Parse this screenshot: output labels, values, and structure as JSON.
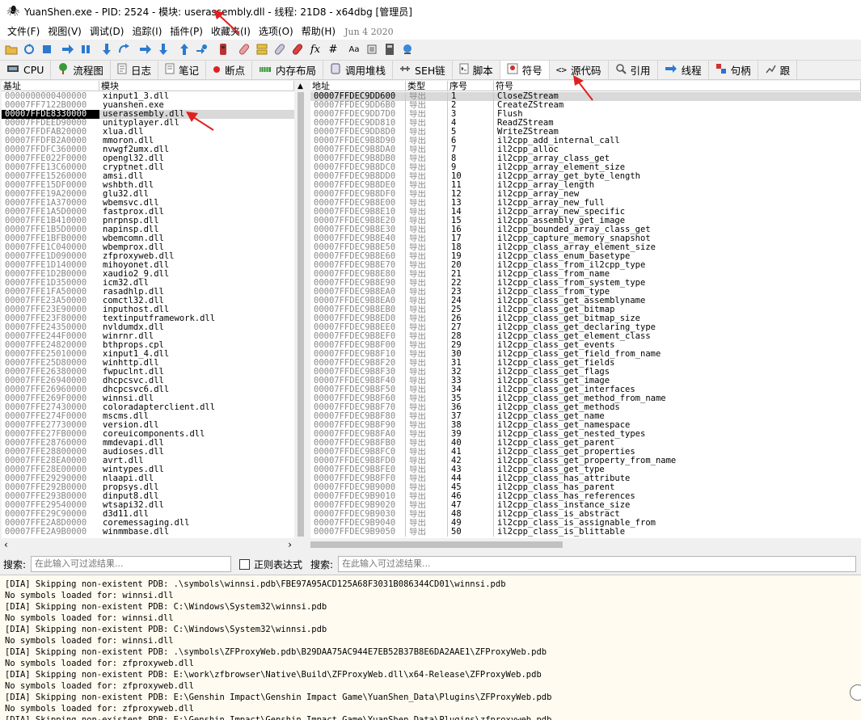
{
  "window": {
    "title": "YuanShen.exe - PID: 2524 - 模块: userassembly.dll - 线程: 21D8 - x64dbg [管理员]"
  },
  "menu": {
    "items": [
      "文件(F)",
      "视图(V)",
      "调试(D)",
      "追踪(I)",
      "插件(P)",
      "收藏夹(I)",
      "选项(O)",
      "帮助(H)"
    ],
    "date": "Jun 4 2020"
  },
  "toolbar": {
    "icons": [
      "open-icon",
      "restart-icon",
      "stop-icon",
      "run-icon",
      "pause-icon",
      "step-into-icon",
      "step-over-icon",
      "trace-into-icon",
      "trace-over-icon",
      "execute-till-return-icon",
      "run-to-user-code-icon",
      "scylla-icon",
      "comment-icon",
      "label-icon",
      "bookmark-icon",
      "function-icon",
      "fx-icon",
      "hash-icon",
      "font-icon",
      "settings-icon",
      "calculator-icon",
      "globe-icon"
    ],
    "hash_label": "#",
    "fx_label": "fx",
    "font_label": "Aa"
  },
  "tabs": [
    {
      "label": "CPU",
      "icon": "cpu-icon"
    },
    {
      "label": "流程图",
      "icon": "graph-icon"
    },
    {
      "label": "日志",
      "icon": "log-icon"
    },
    {
      "label": "笔记",
      "icon": "notes-icon"
    },
    {
      "label": "断点",
      "icon": "breakpoint-icon"
    },
    {
      "label": "内存布局",
      "icon": "memory-map-icon"
    },
    {
      "label": "调用堆栈",
      "icon": "call-stack-icon"
    },
    {
      "label": "SEH链",
      "icon": "seh-icon"
    },
    {
      "label": "脚本",
      "icon": "script-icon"
    },
    {
      "label": "符号",
      "icon": "symbols-icon",
      "active": true
    },
    {
      "label": "源代码",
      "icon": "source-icon"
    },
    {
      "label": "引用",
      "icon": "references-icon"
    },
    {
      "label": "线程",
      "icon": "threads-icon"
    },
    {
      "label": "句柄",
      "icon": "handles-icon"
    },
    {
      "label": "跟",
      "icon": "trace-icon"
    }
  ],
  "modules": {
    "headers": {
      "base": "基址",
      "module": "模块"
    },
    "rows": [
      {
        "base": "0000000000400000",
        "name": "xinput1_3.dll"
      },
      {
        "base": "00007FF7122B0000",
        "name": "yuanshen.exe"
      },
      {
        "base": "00007FFDE8330000",
        "name": "userassembly.dll",
        "selected": true
      },
      {
        "base": "00007FFDEED90000",
        "name": "unityplayer.dll"
      },
      {
        "base": "00007FFDFAB20000",
        "name": "xlua.dll"
      },
      {
        "base": "00007FFDFB2A0000",
        "name": "mmoron.dll"
      },
      {
        "base": "00007FFDFC360000",
        "name": "nvwgf2umx.dll"
      },
      {
        "base": "00007FFE022F0000",
        "name": "opengl32.dll"
      },
      {
        "base": "00007FFE13C60000",
        "name": "cryptnet.dll"
      },
      {
        "base": "00007FFE15260000",
        "name": "amsi.dll"
      },
      {
        "base": "00007FFE15DF0000",
        "name": "wshbth.dll"
      },
      {
        "base": "00007FFE19A20000",
        "name": "glu32.dll"
      },
      {
        "base": "00007FFE1A370000",
        "name": "wbemsvc.dll"
      },
      {
        "base": "00007FFE1A5D0000",
        "name": "fastprox.dll"
      },
      {
        "base": "00007FFE1B410000",
        "name": "pnrpnsp.dll"
      },
      {
        "base": "00007FFE1B5D0000",
        "name": "napinsp.dll"
      },
      {
        "base": "00007FFE1BFB0000",
        "name": "wbemcomn.dll"
      },
      {
        "base": "00007FFE1C040000",
        "name": "wbemprox.dll"
      },
      {
        "base": "00007FFE1D090000",
        "name": "zfproxyweb.dll"
      },
      {
        "base": "00007FFE1D140000",
        "name": "mihoyonet.dll"
      },
      {
        "base": "00007FFE1D2B0000",
        "name": "xaudio2_9.dll"
      },
      {
        "base": "00007FFE1D350000",
        "name": "icm32.dll"
      },
      {
        "base": "00007FFE1FA50000",
        "name": "rasadhlp.dll"
      },
      {
        "base": "00007FFE23A50000",
        "name": "comctl32.dll"
      },
      {
        "base": "00007FFE23E90000",
        "name": "inputhost.dll"
      },
      {
        "base": "00007FFE23F80000",
        "name": "textinputframework.dll"
      },
      {
        "base": "00007FFE24350000",
        "name": "nvldumdx.dll"
      },
      {
        "base": "00007FFE244F0000",
        "name": "winrnr.dll"
      },
      {
        "base": "00007FFE24820000",
        "name": "bthprops.cpl"
      },
      {
        "base": "00007FFE25010000",
        "name": "xinput1_4.dll"
      },
      {
        "base": "00007FFE25D80000",
        "name": "winhttp.dll"
      },
      {
        "base": "00007FFE26380000",
        "name": "fwpuclnt.dll"
      },
      {
        "base": "00007FFE26940000",
        "name": "dhcpcsvc.dll"
      },
      {
        "base": "00007FFE26960000",
        "name": "dhcpcsvc6.dll"
      },
      {
        "base": "00007FFE269F0000",
        "name": "winnsi.dll"
      },
      {
        "base": "00007FFE27430000",
        "name": "coloradapterclient.dll"
      },
      {
        "base": "00007FFE274F0000",
        "name": "mscms.dll"
      },
      {
        "base": "00007FFE27730000",
        "name": "version.dll"
      },
      {
        "base": "00007FFE27FB0000",
        "name": "coreuicomponents.dll"
      },
      {
        "base": "00007FFE28760000",
        "name": "mmdevapi.dll"
      },
      {
        "base": "00007FFE28800000",
        "name": "audioses.dll"
      },
      {
        "base": "00007FFE28EA0000",
        "name": "avrt.dll"
      },
      {
        "base": "00007FFE28E00000",
        "name": "wintypes.dll"
      },
      {
        "base": "00007FFE29290000",
        "name": "nlaapi.dll"
      },
      {
        "base": "00007FFE292B0000",
        "name": "propsys.dll"
      },
      {
        "base": "00007FFE293B0000",
        "name": "dinput8.dll"
      },
      {
        "base": "00007FFE29540000",
        "name": "wtsapi32.dll"
      },
      {
        "base": "00007FFE29C90000",
        "name": "d3d11.dll"
      },
      {
        "base": "00007FFE2A8D0000",
        "name": "coremessaging.dll"
      },
      {
        "base": "00007FFE2A9B0000",
        "name": "winmmbase.dll"
      }
    ]
  },
  "symbols": {
    "headers": {
      "address": "地址",
      "type": "类型",
      "ordinal": "序号",
      "symbol": "符号"
    },
    "type_value": "导出",
    "rows": [
      {
        "addr": "00007FFDEC9DD600",
        "ord": "1",
        "sym": "CloseZStream"
      },
      {
        "addr": "00007FFDEC9DD6B0",
        "ord": "2",
        "sym": "CreateZStream"
      },
      {
        "addr": "00007FFDEC9DD7D0",
        "ord": "3",
        "sym": "Flush"
      },
      {
        "addr": "00007FFDEC9DD810",
        "ord": "4",
        "sym": "ReadZStream"
      },
      {
        "addr": "00007FFDEC9DD8D0",
        "ord": "5",
        "sym": "WriteZStream"
      },
      {
        "addr": "00007FFDEC9B8D90",
        "ord": "6",
        "sym": "il2cpp_add_internal_call"
      },
      {
        "addr": "00007FFDEC9B8DA0",
        "ord": "7",
        "sym": "il2cpp_alloc"
      },
      {
        "addr": "00007FFDEC9B8DB0",
        "ord": "8",
        "sym": "il2cpp_array_class_get"
      },
      {
        "addr": "00007FFDEC9B8DC0",
        "ord": "9",
        "sym": "il2cpp_array_element_size"
      },
      {
        "addr": "00007FFDEC9B8DD0",
        "ord": "10",
        "sym": "il2cpp_array_get_byte_length"
      },
      {
        "addr": "00007FFDEC9B8DE0",
        "ord": "11",
        "sym": "il2cpp_array_length"
      },
      {
        "addr": "00007FFDEC9B8DF0",
        "ord": "12",
        "sym": "il2cpp_array_new"
      },
      {
        "addr": "00007FFDEC9B8E00",
        "ord": "13",
        "sym": "il2cpp_array_new_full"
      },
      {
        "addr": "00007FFDEC9B8E10",
        "ord": "14",
        "sym": "il2cpp_array_new_specific"
      },
      {
        "addr": "00007FFDEC9B8E20",
        "ord": "15",
        "sym": "il2cpp_assembly_get_image"
      },
      {
        "addr": "00007FFDEC9B8E30",
        "ord": "16",
        "sym": "il2cpp_bounded_array_class_get"
      },
      {
        "addr": "00007FFDEC9B8E40",
        "ord": "17",
        "sym": "il2cpp_capture_memory_snapshot"
      },
      {
        "addr": "00007FFDEC9B8E50",
        "ord": "18",
        "sym": "il2cpp_class_array_element_size"
      },
      {
        "addr": "00007FFDEC9B8E60",
        "ord": "19",
        "sym": "il2cpp_class_enum_basetype"
      },
      {
        "addr": "00007FFDEC9B8E70",
        "ord": "20",
        "sym": "il2cpp_class_from_il2cpp_type"
      },
      {
        "addr": "00007FFDEC9B8E80",
        "ord": "21",
        "sym": "il2cpp_class_from_name"
      },
      {
        "addr": "00007FFDEC9B8E90",
        "ord": "22",
        "sym": "il2cpp_class_from_system_type"
      },
      {
        "addr": "00007FFDEC9B8EA0",
        "ord": "23",
        "sym": "il2cpp_class_from_type"
      },
      {
        "addr": "00007FFDEC9B8EA0",
        "ord": "24",
        "sym": "il2cpp_class_get_assemblyname"
      },
      {
        "addr": "00007FFDEC9B8EB0",
        "ord": "25",
        "sym": "il2cpp_class_get_bitmap"
      },
      {
        "addr": "00007FFDEC9B8ED0",
        "ord": "26",
        "sym": "il2cpp_class_get_bitmap_size"
      },
      {
        "addr": "00007FFDEC9B8EE0",
        "ord": "27",
        "sym": "il2cpp_class_get_declaring_type"
      },
      {
        "addr": "00007FFDEC9B8EF0",
        "ord": "28",
        "sym": "il2cpp_class_get_element_class"
      },
      {
        "addr": "00007FFDEC9B8F00",
        "ord": "29",
        "sym": "il2cpp_class_get_events"
      },
      {
        "addr": "00007FFDEC9B8F10",
        "ord": "30",
        "sym": "il2cpp_class_get_field_from_name"
      },
      {
        "addr": "00007FFDEC9B8F20",
        "ord": "31",
        "sym": "il2cpp_class_get_fields"
      },
      {
        "addr": "00007FFDEC9B8F30",
        "ord": "32",
        "sym": "il2cpp_class_get_flags"
      },
      {
        "addr": "00007FFDEC9B8F40",
        "ord": "33",
        "sym": "il2cpp_class_get_image"
      },
      {
        "addr": "00007FFDEC9B8F50",
        "ord": "34",
        "sym": "il2cpp_class_get_interfaces"
      },
      {
        "addr": "00007FFDEC9B8F60",
        "ord": "35",
        "sym": "il2cpp_class_get_method_from_name"
      },
      {
        "addr": "00007FFDEC9B8F70",
        "ord": "36",
        "sym": "il2cpp_class_get_methods"
      },
      {
        "addr": "00007FFDEC9B8F80",
        "ord": "37",
        "sym": "il2cpp_class_get_name"
      },
      {
        "addr": "00007FFDEC9B8F90",
        "ord": "38",
        "sym": "il2cpp_class_get_namespace"
      },
      {
        "addr": "00007FFDEC9B8FA0",
        "ord": "39",
        "sym": "il2cpp_class_get_nested_types"
      },
      {
        "addr": "00007FFDEC9B8FB0",
        "ord": "40",
        "sym": "il2cpp_class_get_parent"
      },
      {
        "addr": "00007FFDEC9B8FC0",
        "ord": "41",
        "sym": "il2cpp_class_get_properties"
      },
      {
        "addr": "00007FFDEC9B8FD0",
        "ord": "42",
        "sym": "il2cpp_class_get_property_from_name"
      },
      {
        "addr": "00007FFDEC9B8FE0",
        "ord": "43",
        "sym": "il2cpp_class_get_type"
      },
      {
        "addr": "00007FFDEC9B8FF0",
        "ord": "44",
        "sym": "il2cpp_class_has_attribute"
      },
      {
        "addr": "00007FFDEC9B9000",
        "ord": "45",
        "sym": "il2cpp_class_has_parent"
      },
      {
        "addr": "00007FFDEC9B9010",
        "ord": "46",
        "sym": "il2cpp_class_has_references"
      },
      {
        "addr": "00007FFDEC9B9020",
        "ord": "47",
        "sym": "il2cpp_class_instance_size"
      },
      {
        "addr": "00007FFDEC9B9030",
        "ord": "48",
        "sym": "il2cpp_class_is_abstract"
      },
      {
        "addr": "00007FFDEC9B9040",
        "ord": "49",
        "sym": "il2cpp_class_is_assignable_from"
      },
      {
        "addr": "00007FFDEC9B9050",
        "ord": "50",
        "sym": "il2cpp_class_is_blittable"
      }
    ]
  },
  "search": {
    "label": "搜索:",
    "placeholder": "在此输入可过滤结果...",
    "regex_label": "正则表达式",
    "label2": "搜索:",
    "placeholder2": "在此输入可过滤结果..."
  },
  "log": {
    "lines": [
      "[DIA] Skipping non-existent PDB: .\\symbols\\winnsi.pdb\\FBE97A95ACD125A68F3031B086344CD01\\winnsi.pdb",
      "No symbols loaded for: winnsi.dll",
      "[DIA] Skipping non-existent PDB: C:\\Windows\\System32\\winnsi.pdb",
      "No symbols loaded for: winnsi.dll",
      "[DIA] Skipping non-existent PDB: C:\\Windows\\System32\\winnsi.pdb",
      "No symbols loaded for: winnsi.dll",
      "[DIA] Skipping non-existent PDB: .\\symbols\\ZFProxyWeb.pdb\\B29DAA75AC944E7EB52B37B8E6DA2AAE1\\ZFProxyWeb.pdb",
      "No symbols loaded for: zfproxyweb.dll",
      "[DIA] Skipping non-existent PDB: E:\\work\\zfbrowser\\Native\\Build\\ZFProxyWeb.dll\\x64-Release\\ZFProxyWeb.pdb",
      "No symbols loaded for: zfproxyweb.dll",
      "[DIA] Skipping non-existent PDB: E:\\Genshin Impact\\Genshin Impact Game\\YuanShen_Data\\Plugins\\ZFProxyWeb.pdb",
      "No symbols loaded for: zfproxyweb.dll",
      "[DIA] Skipping non-existent PDB: E:\\Genshin Impact\\Genshin Impact Game\\YuanShen_Data\\Plugins\\zfproxyweb.pdb"
    ]
  }
}
